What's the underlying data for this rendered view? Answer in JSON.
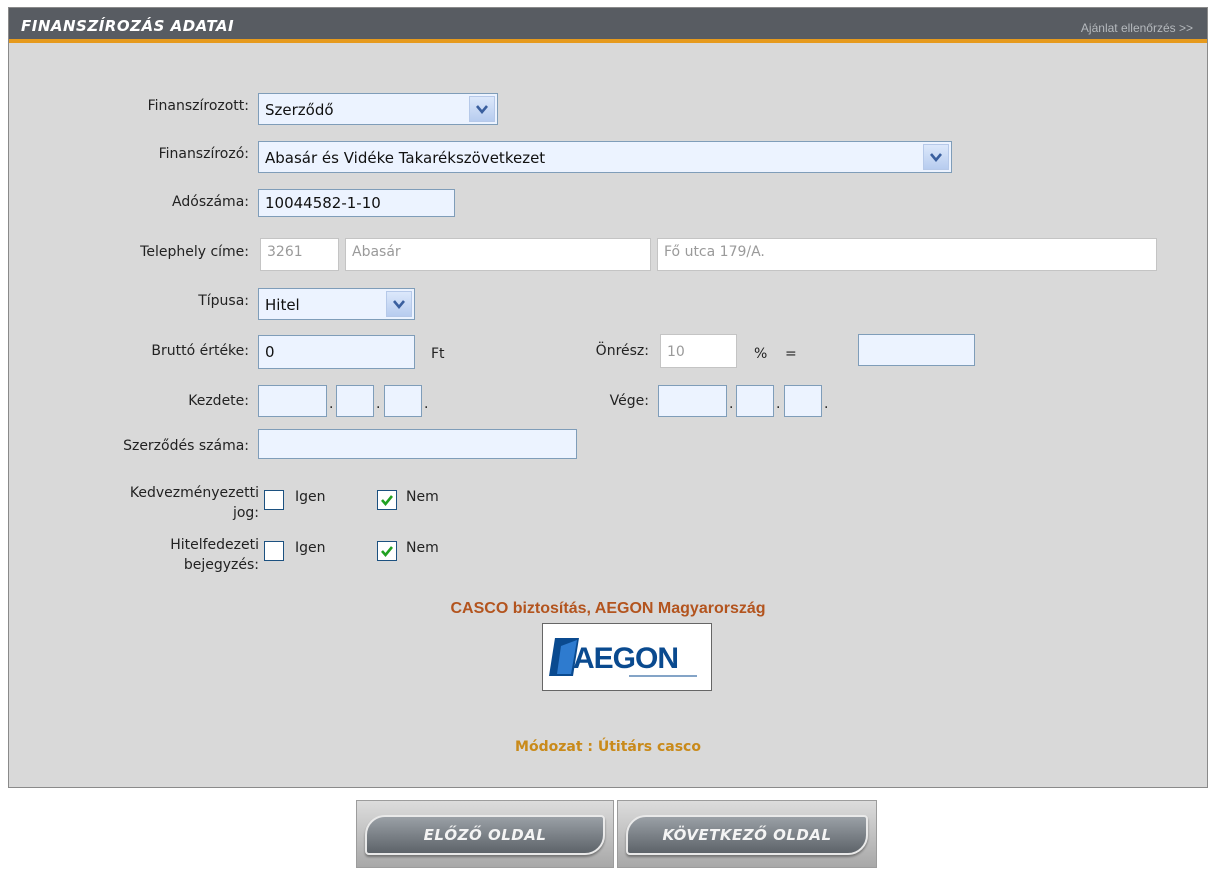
{
  "header": {
    "title": "FINANSZÍROZÁS ADATAI",
    "link": "Ajánlat ellenőrzés >>"
  },
  "form": {
    "finanszirozott": {
      "label": "Finanszírozott:",
      "value": "Szerződő"
    },
    "finanszirozo": {
      "label": "Finanszírozó:",
      "value": "Abasár és Vidéke Takarékszövetkezet"
    },
    "adoszama": {
      "label": "Adószáma:",
      "value": "10044582-1-10"
    },
    "telephely": {
      "label": "Telephely címe:",
      "zip": "3261",
      "city": "Abasár",
      "street": "Fő utca 179/A."
    },
    "tipusa": {
      "label": "Típusa:",
      "value": "Hitel"
    },
    "brutto": {
      "label": "Bruttó értéke:",
      "value": "0",
      "unit": "Ft"
    },
    "onresz": {
      "label": "Önrész:",
      "value": "10",
      "percent": "%",
      "equals": "=",
      "result": ""
    },
    "kezdete": {
      "label": "Kezdete:",
      "year": "",
      "month": "",
      "day": ""
    },
    "vege": {
      "label": "Vége:",
      "year": "",
      "month": "",
      "day": ""
    },
    "szerzodes_szama": {
      "label": "Szerződés száma:",
      "value": ""
    },
    "kedvezmenyezetti": {
      "label_line1": "Kedvezményezetti",
      "label_line2": "jog:",
      "yes": "Igen",
      "no": "Nem",
      "yes_checked": false,
      "no_checked": true
    },
    "hitelfedezeti": {
      "label_line1": "Hitelfedezeti",
      "label_line2": "bejegyzés:",
      "yes": "Igen",
      "no": "Nem",
      "yes_checked": false,
      "no_checked": true
    },
    "date_separator": "."
  },
  "insurer": {
    "product_line": "CASCO biztosítás, AEGON Magyarország",
    "logo_text": "AEGON",
    "modozat": "Módozat : Útitárs casco"
  },
  "nav": {
    "prev": "ELŐZŐ OLDAL",
    "next": "KÖVETKEZŐ OLDAL"
  },
  "colors": {
    "header_bg": "#585c62",
    "header_accent": "#e69a1d",
    "panel_bg": "#d9d9d9",
    "brand_text": "#b3541e",
    "modozat_text": "#c98a1a",
    "aegon_blue": "#0a4a8f"
  }
}
